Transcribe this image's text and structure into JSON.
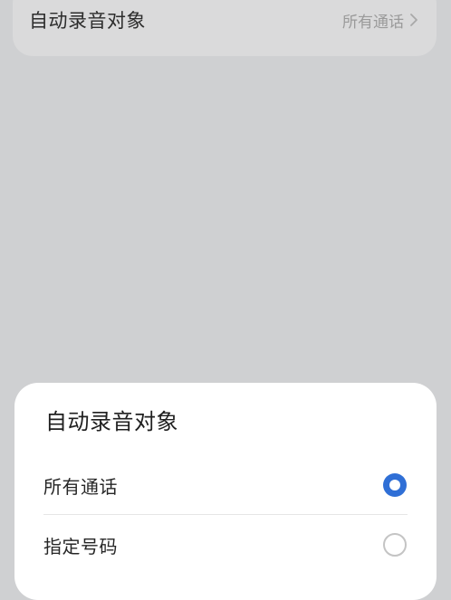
{
  "background_setting": {
    "label": "自动录音对象",
    "value": "所有通话",
    "chevron_icon": "chevron-right-icon"
  },
  "sheet": {
    "title": "自动录音对象",
    "options": [
      {
        "label": "所有通话",
        "selected": true
      },
      {
        "label": "指定号码",
        "selected": false
      }
    ]
  },
  "colors": {
    "overlay": "#cfd0d2",
    "accent": "#2f6fd6",
    "sheet_bg": "#ffffff"
  }
}
